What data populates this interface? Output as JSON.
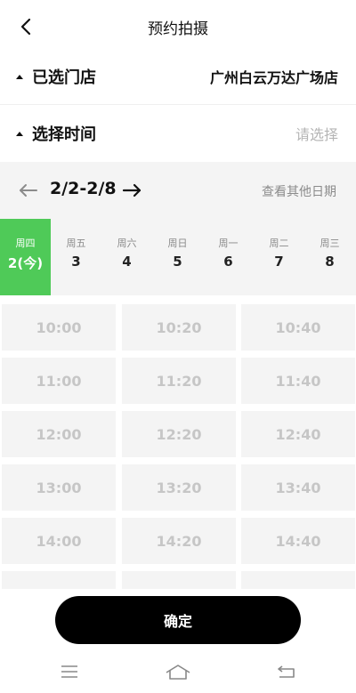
{
  "header": {
    "title": "预约拍摄"
  },
  "store": {
    "label": "已选门店",
    "value": "广州白云万达广场店"
  },
  "time": {
    "label": "选择时间",
    "placeholder": "请选择"
  },
  "date_range": {
    "text": "2/2-2/8",
    "other_dates": "查看其他日期"
  },
  "days": [
    {
      "weekday": "周四",
      "date": "2(今)",
      "selected": true
    },
    {
      "weekday": "周五",
      "date": "3"
    },
    {
      "weekday": "周六",
      "date": "4"
    },
    {
      "weekday": "周日",
      "date": "5"
    },
    {
      "weekday": "周一",
      "date": "6"
    },
    {
      "weekday": "周二",
      "date": "7"
    },
    {
      "weekday": "周三",
      "date": "8"
    }
  ],
  "slots": [
    [
      "10:00",
      "10:20",
      "10:40"
    ],
    [
      "11:00",
      "11:20",
      "11:40"
    ],
    [
      "12:00",
      "12:20",
      "12:40"
    ],
    [
      "13:00",
      "13:20",
      "13:40"
    ],
    [
      "14:00",
      "14:20",
      "14:40"
    ]
  ],
  "confirm": {
    "label": "确定"
  },
  "colors": {
    "accent": "#4fca58",
    "slot_text_disabled": "#c6c6c6",
    "button": "#000000"
  },
  "icons": {
    "back": "chevron-left-icon",
    "prev": "arrow-left-icon",
    "next": "arrow-right-icon",
    "menu": "menu-icon",
    "home": "home-icon",
    "return": "return-icon"
  }
}
